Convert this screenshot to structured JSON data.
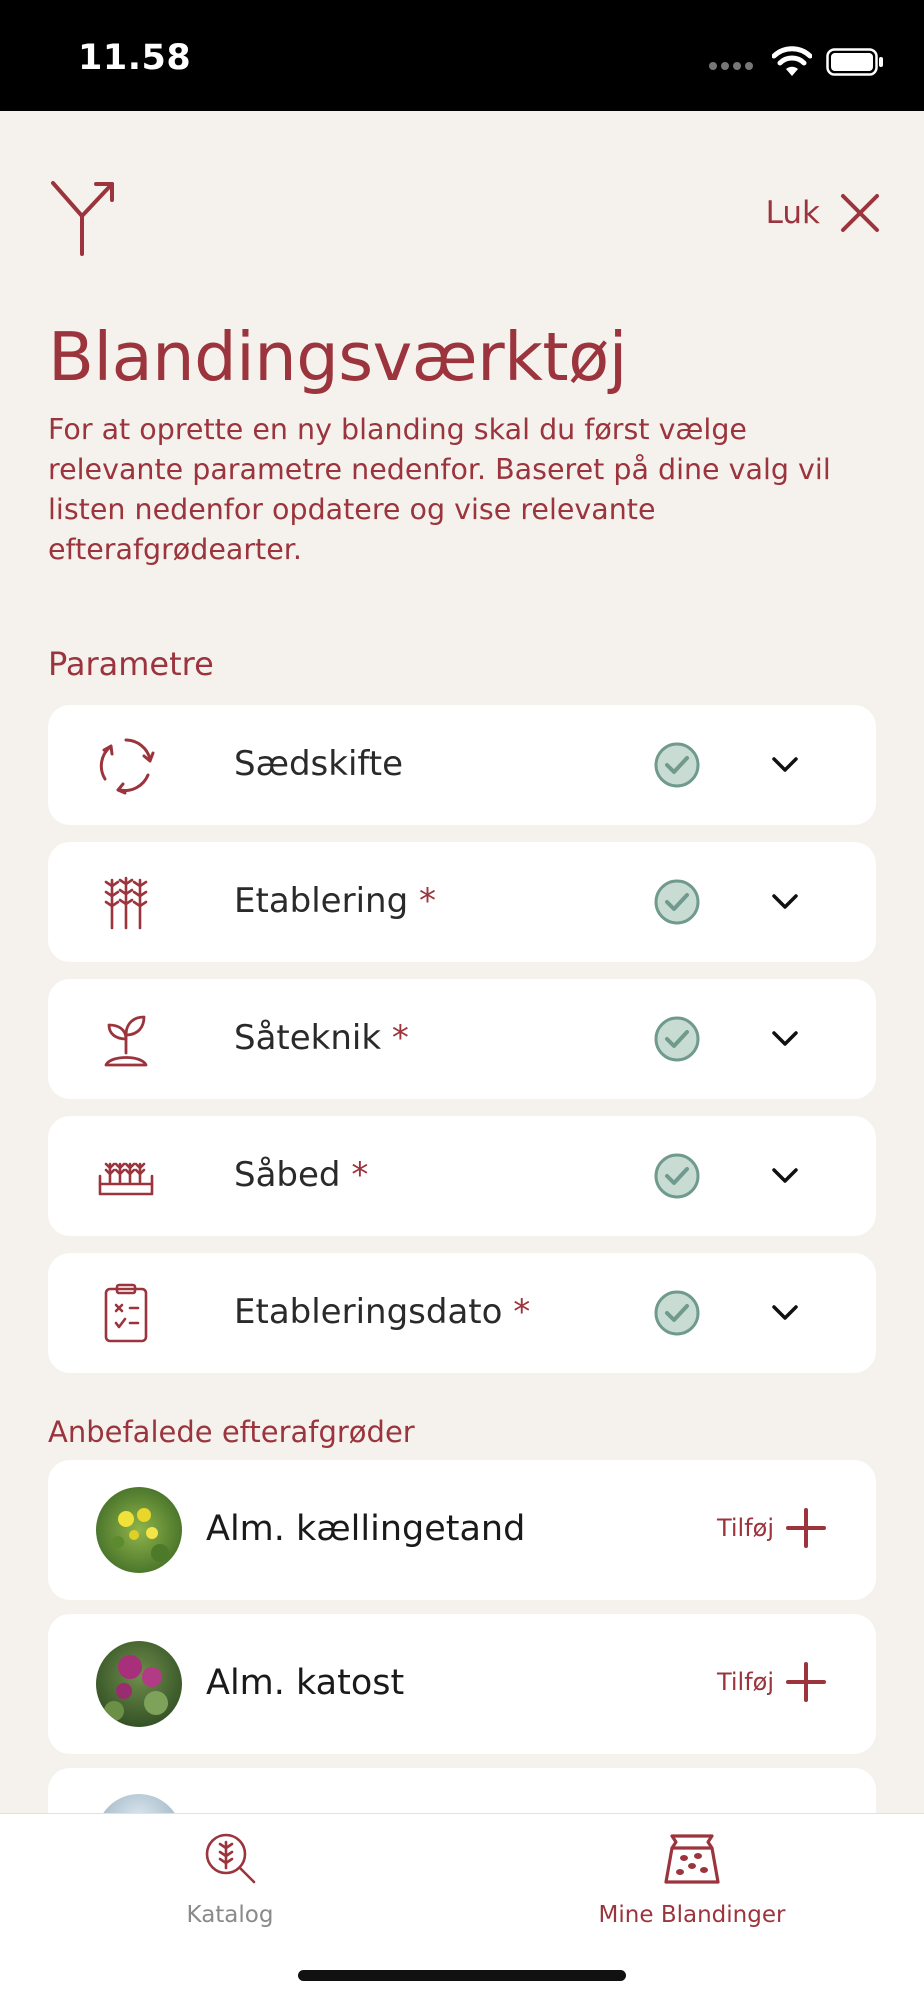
{
  "status": {
    "time": "11.58"
  },
  "header": {
    "close_label": "Luk"
  },
  "title": "Blandingsværktøj",
  "intro": "For at oprette en ny blanding skal du først vælge relevante parametre nedenfor. Baseret på dine valg vil listen nedenfor opdatere og vise relevante efterafgrødearter.",
  "params_heading": "Parametre",
  "params": [
    {
      "label": "Sædskifte",
      "required": "",
      "icon": "rotation-icon",
      "done": true
    },
    {
      "label": "Etablering",
      "required": "*",
      "icon": "wheat-icon",
      "done": true
    },
    {
      "label": "Såteknik",
      "required": "*",
      "icon": "sprout-icon",
      "done": true
    },
    {
      "label": "Såbed",
      "required": "*",
      "icon": "seedbed-icon",
      "done": true
    },
    {
      "label": "Etableringsdato",
      "required": "*",
      "icon": "clipboard-icon",
      "done": true
    }
  ],
  "recommended_heading": "Anbefalede efterafgrøder",
  "crops": [
    {
      "name": "Alm. kællingetand",
      "add_label": "Tilføj"
    },
    {
      "name": "Alm. katost",
      "add_label": "Tilføj"
    }
  ],
  "tabs": [
    {
      "label": "Katalog",
      "icon": "catalog-search-icon",
      "active": false
    },
    {
      "label": "Mine Blandinger",
      "icon": "seed-bag-icon",
      "active": true
    }
  ],
  "colors": {
    "accent": "#9b343c",
    "background": "#f5f2ee",
    "check": "#6f9a8d",
    "inactive_tab": "#8a8a8a"
  }
}
